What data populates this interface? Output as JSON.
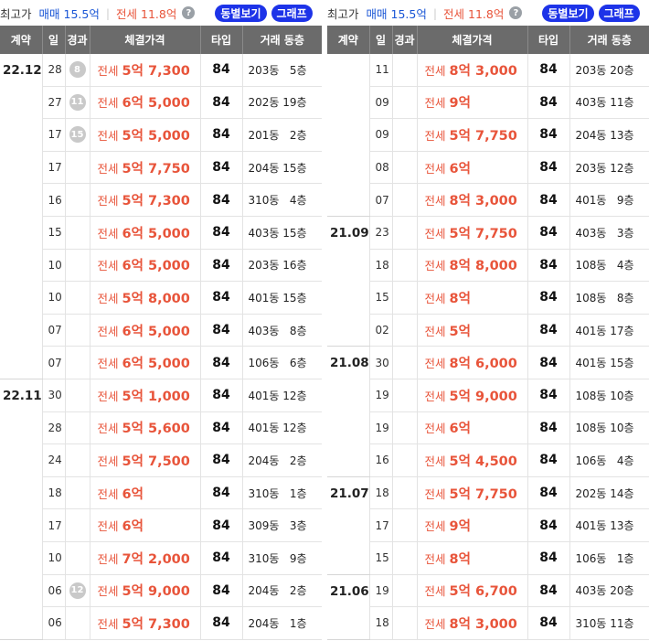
{
  "summary": {
    "label": "최고가",
    "sale": "매매 15.5억",
    "jeonse": "전세 11.8억",
    "help": "?",
    "btn_dong": "동별보기",
    "btn_graph": "그래프"
  },
  "headers": [
    "계약",
    "일",
    "경과",
    "체결가격",
    "타입",
    "거래 동층"
  ],
  "left_groups": [
    {
      "month": "22.12",
      "rows": [
        {
          "day": "28",
          "elapsed": "8",
          "kind": "전세",
          "amt": "5억 7,300",
          "type": "84",
          "dong": "203동",
          "floor": "5층"
        },
        {
          "day": "27",
          "elapsed": "11",
          "kind": "전세",
          "amt": "6억 5,000",
          "type": "84",
          "dong": "202동",
          "floor": "19층"
        },
        {
          "day": "17",
          "elapsed": "15",
          "kind": "전세",
          "amt": "5억 5,000",
          "type": "84",
          "dong": "201동",
          "floor": "2층"
        },
        {
          "day": "17",
          "elapsed": "",
          "kind": "전세",
          "amt": "5억 7,750",
          "type": "84",
          "dong": "204동",
          "floor": "15층"
        },
        {
          "day": "16",
          "elapsed": "",
          "kind": "전세",
          "amt": "5억 7,300",
          "type": "84",
          "dong": "310동",
          "floor": "4층"
        },
        {
          "day": "15",
          "elapsed": "",
          "kind": "전세",
          "amt": "6억 5,000",
          "type": "84",
          "dong": "403동",
          "floor": "15층"
        },
        {
          "day": "10",
          "elapsed": "",
          "kind": "전세",
          "amt": "6억 5,000",
          "type": "84",
          "dong": "203동",
          "floor": "16층"
        },
        {
          "day": "10",
          "elapsed": "",
          "kind": "전세",
          "amt": "5억 8,000",
          "type": "84",
          "dong": "401동",
          "floor": "15층"
        },
        {
          "day": "07",
          "elapsed": "",
          "kind": "전세",
          "amt": "6억 5,000",
          "type": "84",
          "dong": "403동",
          "floor": "8층"
        },
        {
          "day": "07",
          "elapsed": "",
          "kind": "전세",
          "amt": "6억 5,000",
          "type": "84",
          "dong": "106동",
          "floor": "6층"
        }
      ]
    },
    {
      "month": "22.11",
      "rows": [
        {
          "day": "30",
          "elapsed": "",
          "kind": "전세",
          "amt": "5억 1,000",
          "type": "84",
          "dong": "401동",
          "floor": "12층"
        },
        {
          "day": "28",
          "elapsed": "",
          "kind": "전세",
          "amt": "5억 5,600",
          "type": "84",
          "dong": "401동",
          "floor": "12층"
        },
        {
          "day": "24",
          "elapsed": "",
          "kind": "전세",
          "amt": "5억 7,500",
          "type": "84",
          "dong": "204동",
          "floor": "2층"
        },
        {
          "day": "18",
          "elapsed": "",
          "kind": "전세",
          "amt": "6억",
          "type": "84",
          "dong": "310동",
          "floor": "1층"
        },
        {
          "day": "17",
          "elapsed": "",
          "kind": "전세",
          "amt": "6억",
          "type": "84",
          "dong": "309동",
          "floor": "3층"
        },
        {
          "day": "10",
          "elapsed": "",
          "kind": "전세",
          "amt": "7억 2,000",
          "type": "84",
          "dong": "310동",
          "floor": "9층"
        },
        {
          "day": "06",
          "elapsed": "12",
          "kind": "전세",
          "amt": "5억 9,000",
          "type": "84",
          "dong": "204동",
          "floor": "2층"
        },
        {
          "day": "06",
          "elapsed": "",
          "kind": "전세",
          "amt": "5억 7,300",
          "type": "84",
          "dong": "204동",
          "floor": "1층"
        }
      ]
    }
  ],
  "right_groups": [
    {
      "month": "",
      "rows": [
        {
          "day": "11",
          "elapsed": "",
          "kind": "전세",
          "amt": "8억 3,000",
          "type": "84",
          "dong": "203동",
          "floor": "20층"
        },
        {
          "day": "09",
          "elapsed": "",
          "kind": "전세",
          "amt": "9억",
          "type": "84",
          "dong": "403동",
          "floor": "11층"
        },
        {
          "day": "09",
          "elapsed": "",
          "kind": "전세",
          "amt": "5억 7,750",
          "type": "84",
          "dong": "204동",
          "floor": "13층"
        },
        {
          "day": "08",
          "elapsed": "",
          "kind": "전세",
          "amt": "6억",
          "type": "84",
          "dong": "203동",
          "floor": "12층"
        },
        {
          "day": "07",
          "elapsed": "",
          "kind": "전세",
          "amt": "8억 3,000",
          "type": "84",
          "dong": "401동",
          "floor": "9층"
        }
      ]
    },
    {
      "month": "21.09",
      "rows": [
        {
          "day": "23",
          "elapsed": "",
          "kind": "전세",
          "amt": "5억 7,750",
          "type": "84",
          "dong": "403동",
          "floor": "3층"
        },
        {
          "day": "18",
          "elapsed": "",
          "kind": "전세",
          "amt": "8억 8,000",
          "type": "84",
          "dong": "108동",
          "floor": "4층"
        },
        {
          "day": "15",
          "elapsed": "",
          "kind": "전세",
          "amt": "8억",
          "type": "84",
          "dong": "108동",
          "floor": "8층"
        },
        {
          "day": "02",
          "elapsed": "",
          "kind": "전세",
          "amt": "5억",
          "type": "84",
          "dong": "401동",
          "floor": "17층"
        }
      ]
    },
    {
      "month": "21.08",
      "rows": [
        {
          "day": "30",
          "elapsed": "",
          "kind": "전세",
          "amt": "8억 6,000",
          "type": "84",
          "dong": "401동",
          "floor": "15층"
        },
        {
          "day": "19",
          "elapsed": "",
          "kind": "전세",
          "amt": "5억 9,000",
          "type": "84",
          "dong": "108동",
          "floor": "10층"
        },
        {
          "day": "19",
          "elapsed": "",
          "kind": "전세",
          "amt": "6억",
          "type": "84",
          "dong": "108동",
          "floor": "10층"
        },
        {
          "day": "16",
          "elapsed": "",
          "kind": "전세",
          "amt": "5억 4,500",
          "type": "84",
          "dong": "106동",
          "floor": "4층"
        }
      ]
    },
    {
      "month": "21.07",
      "rows": [
        {
          "day": "18",
          "elapsed": "",
          "kind": "전세",
          "amt": "5억 7,750",
          "type": "84",
          "dong": "202동",
          "floor": "14층"
        },
        {
          "day": "17",
          "elapsed": "",
          "kind": "전세",
          "amt": "9억",
          "type": "84",
          "dong": "401동",
          "floor": "13층"
        },
        {
          "day": "15",
          "elapsed": "",
          "kind": "전세",
          "amt": "8억",
          "type": "84",
          "dong": "106동",
          "floor": "1층"
        }
      ]
    },
    {
      "month": "21.06",
      "rows": [
        {
          "day": "19",
          "elapsed": "",
          "kind": "전세",
          "amt": "5억 6,700",
          "type": "84",
          "dong": "403동",
          "floor": "20층"
        },
        {
          "day": "18",
          "elapsed": "",
          "kind": "전세",
          "amt": "8억 3,000",
          "type": "84",
          "dong": "310동",
          "floor": "11층"
        }
      ]
    }
  ]
}
